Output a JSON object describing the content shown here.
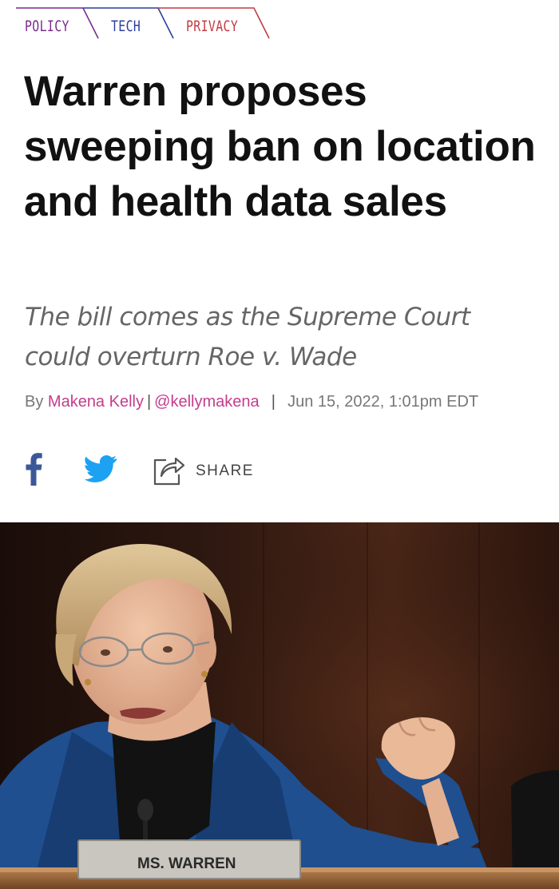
{
  "categories": [
    {
      "label": "POLICY",
      "color": "#7a2a8c"
    },
    {
      "label": "TECH",
      "color": "#2a3f9a"
    },
    {
      "label": "PRIVACY",
      "color": "#c23a44"
    }
  ],
  "article": {
    "headline": "Warren proposes sweeping ban on location and health data sales",
    "dek": "The bill comes as the Supreme Court could overturn Roe v. Wade",
    "byline": {
      "prefix": "By",
      "author": "Makena Kelly",
      "handle": "@kellymakena",
      "date": "Jun 15, 2022, 1:01pm EDT"
    }
  },
  "share": {
    "facebook_icon": "facebook-icon",
    "twitter_icon": "twitter-icon",
    "share_icon": "share-arrow-icon",
    "label": "SHARE"
  },
  "photo": {
    "nameplate": "MS. WARREN"
  },
  "colors": {
    "accent_link": "#c53c8e",
    "facebook": "#3b5998",
    "twitter": "#1da1f2"
  }
}
